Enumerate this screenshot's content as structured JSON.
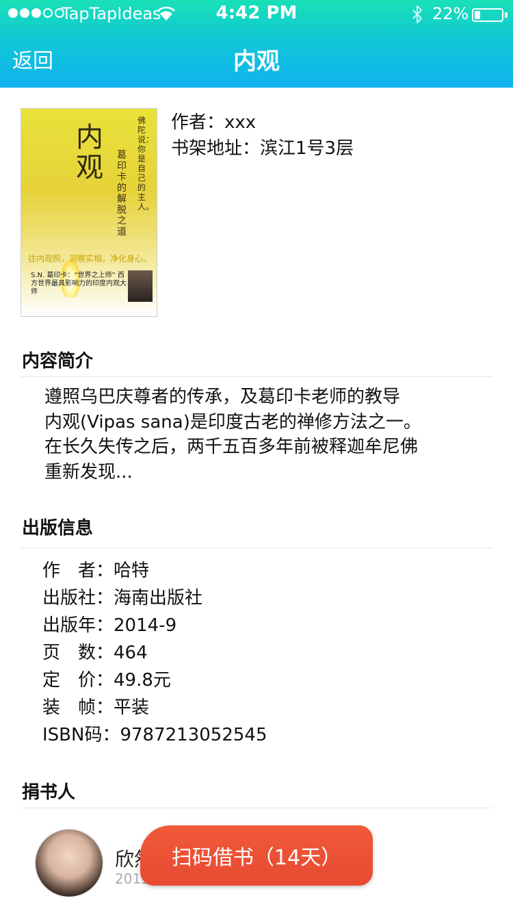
{
  "status_bar": {
    "carrier": "TapTapIdeas",
    "time": "4:42 PM",
    "battery": "22%",
    "battery_level": 0.22
  },
  "nav": {
    "back_label": "返回",
    "title": "内观"
  },
  "book": {
    "cover_title": "内观",
    "cover_subtitle": "葛印卡的解脱之道",
    "cover_side": "佛陀说：你是自己的主人。",
    "cover_tag": "往内观照，洞察实相，净化身心。",
    "cover_author": "S.N. 葛印卡：“世界之上师” 西方世界最具影响力的印度内观大师",
    "author_line": "作者：xxx",
    "shelf_line": "书架地址：滨江1号3层"
  },
  "intro": {
    "heading": "内容简介",
    "lines": [
      "遵照乌巴庆尊者的传承，及葛印卡老师的教导",
      "内观(Vipas sana)是印度古老的禅修方法之一。",
      "在长久失传之后，两千五百多年前被释迦牟尼佛",
      "重新发现..."
    ]
  },
  "publication": {
    "heading": "出版信息",
    "rows": [
      {
        "label": "作　者：",
        "value": "哈特"
      },
      {
        "label": "出版社：",
        "value": "海南出版社"
      },
      {
        "label": "出版年：",
        "value": "2014-9"
      },
      {
        "label": "页　数：",
        "value": "464"
      },
      {
        "label": "定　价：",
        "value": "49.8元"
      },
      {
        "label": "装　帧：",
        "value": "平装"
      },
      {
        "label": "ISBN码：",
        "value": "9787213052545"
      }
    ]
  },
  "donor": {
    "heading": "捐书人",
    "name": "欣然",
    "date": "2015"
  },
  "action": {
    "borrow_label": "扫码借书（14天）"
  }
}
